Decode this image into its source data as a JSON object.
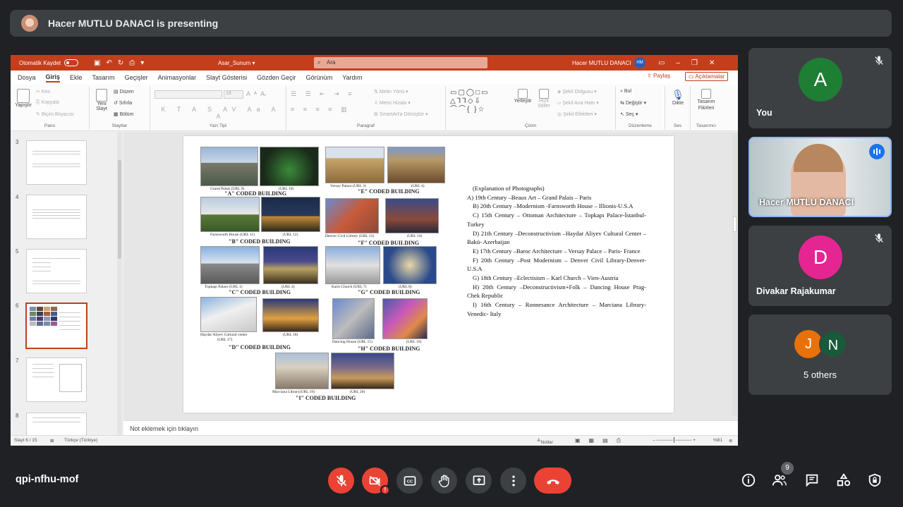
{
  "presenter_bar": {
    "text": "Hacer MUTLU DANACI is presenting"
  },
  "ppt": {
    "autosave_label": "Otomatik Kaydet",
    "file_name": "Asar_Sunum",
    "search_placeholder": "Ara",
    "user_name": "Hacer MUTLU DANACI",
    "user_initials": "HM",
    "menu": [
      "Dosya",
      "Giriş",
      "Ekle",
      "Tasarım",
      "Geçişler",
      "Animasyonlar",
      "Slayt Gösterisi",
      "Gözden Geçir",
      "Görünüm",
      "Yardım"
    ],
    "share_label": "Paylaş",
    "comments_label": "Açıklamalar",
    "ribbon": {
      "paste": "Yapıştır",
      "cut": "Kes",
      "copy": "Kopyala",
      "format_painter": "Biçim Boyacısı",
      "group_clipboard": "Pano",
      "new_slide": "Yeni Slayt",
      "layout": "Düzen",
      "reset": "Sıfırla",
      "section": "Bölüm",
      "group_slides": "Slaytlar",
      "font_size": "18",
      "group_font": "Yazı Tipi",
      "text_direction": "Metin Yönü",
      "align_text": "Metni Hizala",
      "smartart": "SmartArt'a Dönüştür",
      "group_paragraph": "Paragraf",
      "arrange": "Yerleştir",
      "quick_styles": "Hızlı Stiller",
      "shape_fill": "Şekil Dolgusu",
      "shape_outline": "Şekil Ana Hattı",
      "shape_effects": "Şekil Efektleri",
      "group_drawing": "Çizim",
      "find": "Bul",
      "replace": "Değiştir",
      "select": "Seç",
      "group_editing": "Düzenleme",
      "dictate": "Dikte",
      "group_voice": "Ses",
      "designer": "Tasarım Fikirleri",
      "group_designer": "Tasarımcı"
    },
    "thumbnails": [
      {
        "num": "3"
      },
      {
        "num": "4"
      },
      {
        "num": "5"
      },
      {
        "num": "6"
      },
      {
        "num": "7"
      },
      {
        "num": "8"
      }
    ],
    "slide": {
      "captions": {
        "grand_palais": "Grand Palais (URL 9)",
        "url10": "(URL 10)",
        "versay": "Versay Palace (URL 3)",
        "url4a": "(URL 4)",
        "farnsworth": "Farnsworth House (URL 11)",
        "url12": "(URL 12)",
        "denver": "Denver Civil Library (URL 13)",
        "url14": "(URL 14)",
        "topkapi": "Topkapı Palace (URL 1)",
        "url4b": "(URL 4)",
        "karls": "Karls Church (URL 7)",
        "url8": "(URL 8)",
        "haydar": "Haydar Aliyev Cultural centre",
        "url17": "(URL 17)",
        "url18": "(URL 18)",
        "dancing": "Dancing House (URL 15)",
        "url16": "(URL 16)",
        "marciana": "Marciana Library(URL 19)",
        "url20": "(URL 20)"
      },
      "codes": {
        "a": "\"A\" CODED BUILDING",
        "e": "\"E\" CODED BUILDING",
        "b": "\"B\" CODED BUILDING",
        "f": "\"F\" CODED BUILDING",
        "c": "\"C\" CODED BUILDING",
        "g": "\"G\" CODED BUILDING",
        "d": "\"D\" CODED BUILDING",
        "h": "\"H\" CODED BUILDING",
        "i": "\"I\" CODED BUILDING"
      },
      "explanation_title": "(Explanation of Photographs)",
      "explanation": [
        "A)   19th Century –Beaux Art – Grand Palais – Paris",
        "B) 20th Century –Modernism -Farnsworth House – Illionis-U.S.A",
        "C) 15th Century – Ottoman Architecture – Topkapı Palace-İstanbul-Turkey",
        "D) 21th Century –Deconstructivism –Haydar Aliyev Cultural Center – Bakü- Azerbaijan",
        "E) 17th Century –Baroc Architecture – Versay Palace – Paris- France",
        "F) 20th Century –Post Modernism – Denver Civil Library-Denver-U.S.A",
        "G) 18th Century –Eclectisism – Karl Church – Vien-Austria",
        "H) 20th Century –Deconstructivism+Folk – Dancing House Prag- Chek Republic",
        "I) 16th Century – Ronnesance Architecture – Marciana Library- Venedic- Italy"
      ]
    },
    "notes_placeholder": "Not eklemek için tıklayın",
    "status": {
      "slide": "Slayt 6 / 15",
      "language": "Türkçe (Türkiye)",
      "notes": "Notlar",
      "zoom": "%81"
    }
  },
  "participants": [
    {
      "name": "You",
      "initial": "A",
      "color": "#1e7e34"
    },
    {
      "name": "Hacer MUTLU DANACI",
      "initial": ""
    },
    {
      "name": "Divakar Rajakumar",
      "initial": "D",
      "color": "#e52592"
    },
    {
      "name": "5 others",
      "initials": [
        "J",
        "N"
      ]
    }
  ],
  "meeting_code": "qpi-nfhu-mof",
  "participants_count": "9",
  "colors": {
    "end_call": "#ea4335",
    "ppt_accent": "#c43e1c"
  }
}
